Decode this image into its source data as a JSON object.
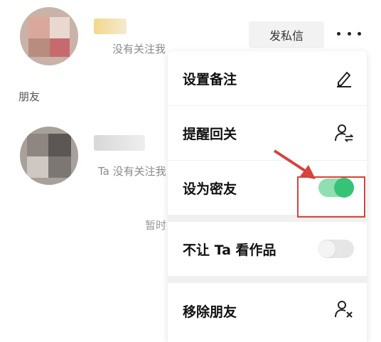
{
  "contacts": [
    {
      "subtitle": "没有关注我"
    },
    {
      "subtitle": "Ta 没有关注我"
    }
  ],
  "section": {
    "friends_label": "朋友"
  },
  "hint": {
    "text": "暂时"
  },
  "header": {
    "message_button": "发私信"
  },
  "menu": {
    "items": [
      {
        "label": "设置备注",
        "icon": "pencil-icon"
      },
      {
        "label": "提醒回关",
        "icon": "user-swap-icon"
      },
      {
        "label": "设为密友",
        "toggle": true,
        "state": "on"
      },
      {
        "label": "不让 Ta 看作品",
        "toggle": true,
        "state": "off"
      },
      {
        "label": "移除朋友",
        "icon": "user-remove-icon"
      }
    ]
  },
  "colors": {
    "toggle_on": "#35c477",
    "toggle_off": "#e6e6e6",
    "annotation": "#d8413e"
  }
}
